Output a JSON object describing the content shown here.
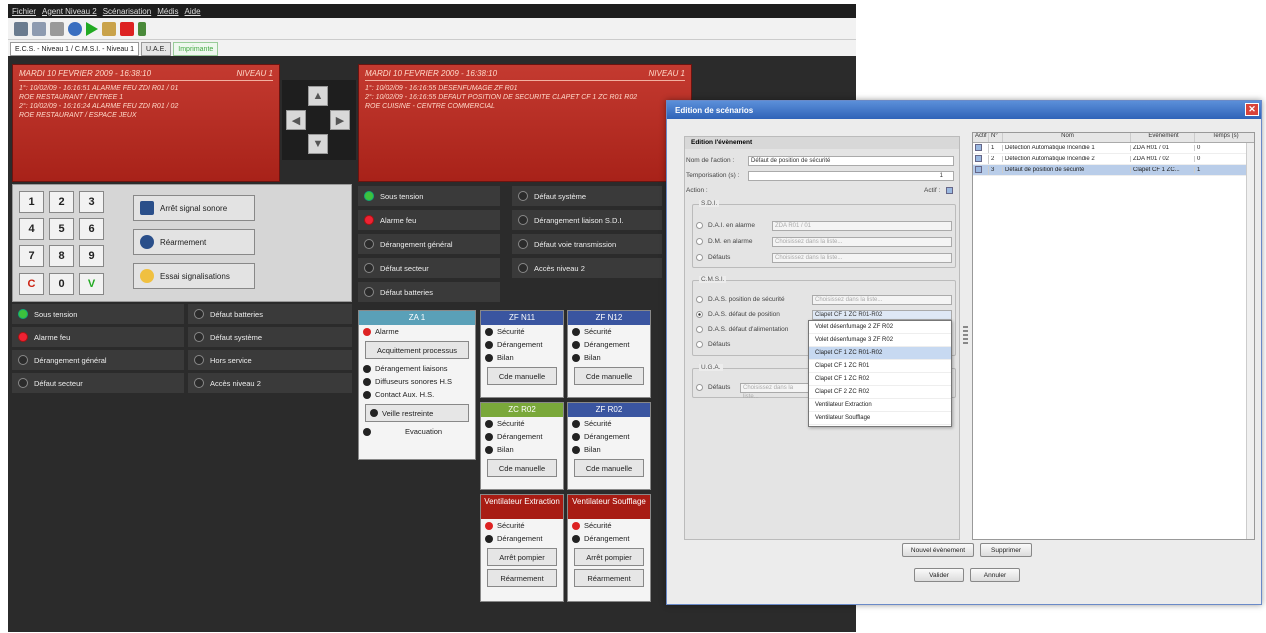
{
  "menu": [
    "Fichier",
    "Agent Niveau 2",
    "Scénarisation",
    "Médis",
    "Aide"
  ],
  "tabs": [
    "E.C.S. - Niveau 1 / C.M.S.I. - Niveau 1",
    "U.A.E.",
    "Imprimante"
  ],
  "left_panel": {
    "header_date": "MARDI 10 FEVRIER 2009 - 16:38:10",
    "header_level": "NIVEAU 1",
    "lines": [
      "1°: 10/02/09 - 16:16:51 ALARME FEU ZDI R01 / 01",
      "ROE RESTAURANT / ENTREE 1",
      "2°: 10/02/09 - 16:16:24 ALARME FEU ZDI R01 / 02",
      "ROE RESTAURANT / ESPACE JEUX"
    ]
  },
  "right_panel": {
    "header_date": "MARDI 10 FEVRIER 2009 - 16:38:10",
    "header_level": "NIVEAU 1",
    "lines": [
      "1°: 10/02/09 - 16:16:55 DESENFUMAGE ZF R01",
      "2°: 10/02/09 - 16:16:55 DEFAUT POSITION DE SECURITE CLAPET CF 1 ZC R01 R02",
      "ROE CUISINE - CENTRE COMMERCIAL"
    ]
  },
  "keypad": [
    "1",
    "2",
    "3",
    "4",
    "5",
    "6",
    "7",
    "8",
    "9",
    "C",
    "0",
    "V"
  ],
  "actions": [
    "Arrêt signal sonore",
    "Réarmement",
    "Essai signalisations"
  ],
  "status_left": [
    {
      "label": "Sous tension",
      "led": "green"
    },
    {
      "label": "Alarme feu",
      "led": "red"
    },
    {
      "label": "Dérangement général",
      "led": "off"
    },
    {
      "label": "Défaut secteur",
      "led": "off"
    }
  ],
  "status_left2": [
    "Défaut batteries",
    "Défaut système",
    "Hors service",
    "Accès niveau 2"
  ],
  "status_right": [
    {
      "label": "Sous tension",
      "led": "green"
    },
    {
      "label": "Alarme feu",
      "led": "red"
    },
    {
      "label": "Dérangement général",
      "led": "off"
    },
    {
      "label": "Défaut secteur",
      "led": "off"
    },
    {
      "label": "Défaut batteries",
      "led": "off"
    }
  ],
  "status_right2": [
    "Défaut système",
    "Dérangement liaison S.D.I.",
    "Défaut voie transmission",
    "Accès niveau 2"
  ],
  "za": {
    "title": "ZA 1",
    "alarme": "Alarme",
    "ack": "Acquittement processus",
    "items": [
      "Dérangement liaisons",
      "Diffuseurs sonores H.S",
      "Contact Aux. H.S."
    ],
    "veille": "Veille restreinte",
    "evac": "Evacuation"
  },
  "cards": [
    {
      "title": "ZF N11",
      "items": [
        "Sécurité",
        "Dérangement",
        "Bilan"
      ],
      "btn": "Cde manuelle"
    },
    {
      "title": "ZF N12",
      "items": [
        "Sécurité",
        "Dérangement",
        "Bilan"
      ],
      "btn": "Cde manuelle"
    },
    {
      "title": "ZC R02",
      "items": [
        "Sécurité",
        "Dérangement",
        "Bilan"
      ],
      "btn": "Cde manuelle"
    },
    {
      "title": "ZF R02",
      "items": [
        "Sécurité",
        "Dérangement",
        "Bilan"
      ],
      "btn": "Cde manuelle"
    },
    {
      "title": "Ventilateur Extraction",
      "items": [
        "Sécurité",
        "Dérangement"
      ],
      "btn": "Arrêt pompier",
      "btn2": "Réarmement"
    },
    {
      "title": "Ventilateur Soufflage",
      "items": [
        "Sécurité",
        "Dérangement"
      ],
      "btn": "Arrêt pompier",
      "btn2": "Réarmement"
    }
  ],
  "dialog": {
    "title": "Edition de scénarios",
    "section": "Edition l'évènement",
    "nom_label": "Nom de l'action :",
    "nom_value": "Défaut de position de sécurité",
    "tempo_label": "Temporisation (s) :",
    "tempo_value": "1",
    "action_label": "Action :",
    "actif_label": "Actif :",
    "sdi": "S.D.I.",
    "sdi_rows": [
      {
        "label": "D.A.I. en alarme",
        "value": "ZDA R01 / 01"
      },
      {
        "label": "D.M. en alarme",
        "value": "Choisissez dans la liste..."
      },
      {
        "label": "Défauts",
        "value": "Choisissez dans la liste..."
      }
    ],
    "cmsi": "C.M.S.I.",
    "cmsi_rows": [
      {
        "label": "D.A.S. position de sécurité",
        "value": "Choisissez dans la liste..."
      },
      {
        "label": "D.A.S. défaut de position",
        "value": "Clapet CF 1 ZC R01-R02"
      },
      {
        "label": "D.A.S. défaut d'alimentation",
        "value": ""
      },
      {
        "label": "Défauts",
        "value": ""
      }
    ],
    "uga": "U.G.A.",
    "uga_rows": [
      {
        "label": "Défauts",
        "value": "Choisissez dans la liste..."
      }
    ],
    "dropdown": [
      "Volet désenfumage 2 ZF R02",
      "Volet désenfumage 3 ZF R02",
      "Clapet CF 1 ZC R01-R02",
      "Clapet CF 1 ZC R01",
      "Clapet CF 1 ZC R02",
      "Clapet CF 2 ZC R02",
      "Ventilateur Extraction",
      "Ventilateur Soufflage"
    ],
    "table_headers": [
      "Actif",
      "N°",
      "Nom",
      "Evènement",
      "Temps (s)"
    ],
    "table_rows": [
      {
        "n": "1",
        "nom": "Détection Automatique Incendie 1",
        "evt": "ZDA R01 / 01",
        "t": "0"
      },
      {
        "n": "2",
        "nom": "Détection Automatique Incendie 2",
        "evt": "ZDA R01 / 02",
        "t": "0"
      },
      {
        "n": "3",
        "nom": "Défaut de position de sécurité",
        "evt": "Clapet CF 1 ZC...",
        "t": "1"
      }
    ],
    "btn_new": "Nouvel évènement",
    "btn_del": "Supprimer",
    "btn_ok": "Valider",
    "btn_cancel": "Annuler"
  },
  "colors": {
    "alarm_red": "#b52a20",
    "accent_blue": "#2f63b8",
    "led_green": "#3dc23d"
  }
}
